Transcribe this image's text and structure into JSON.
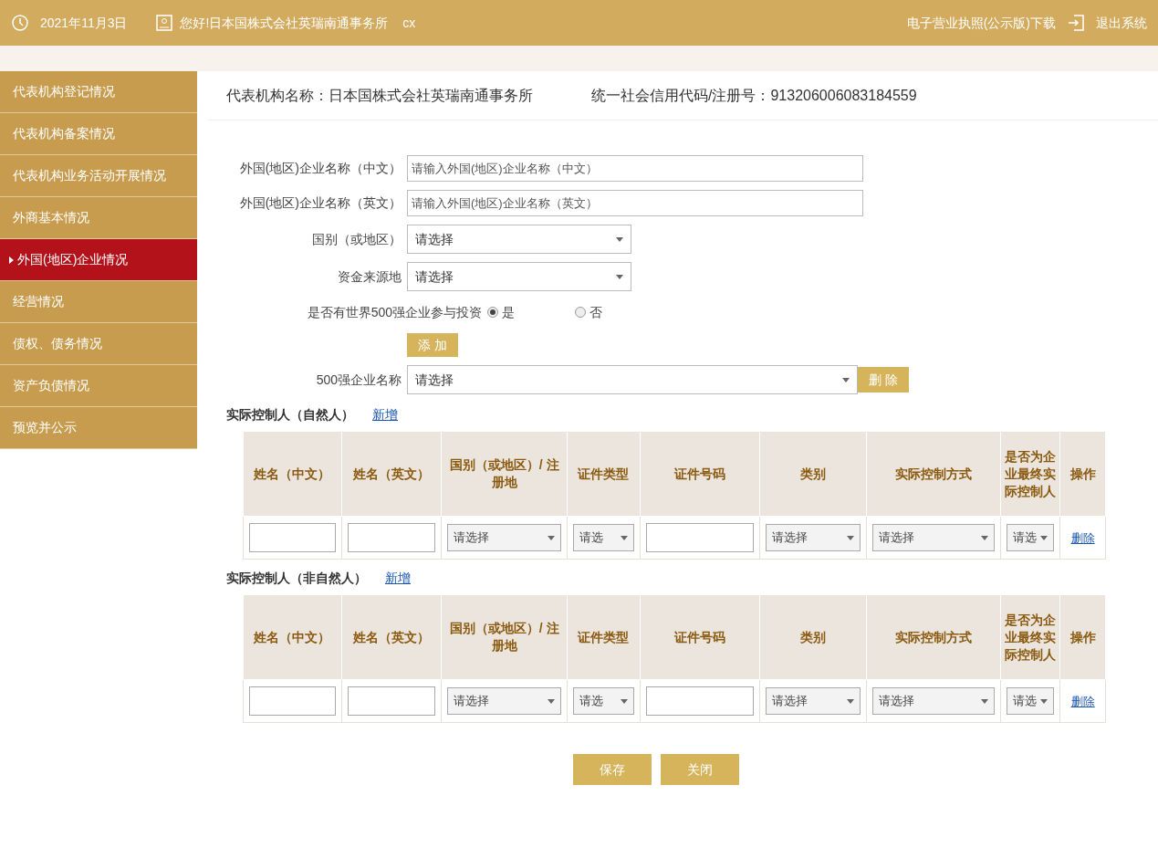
{
  "top_bar": {
    "date": "2021年11月3日",
    "greeting": "您好!日本国株式会社英瑞南通事务所",
    "user": "cx",
    "license_link": "电子营业执照(公示版)下载",
    "logout": "退出系统"
  },
  "sidebar": {
    "items": [
      {
        "label": "代表机构登记情况",
        "selected": false
      },
      {
        "label": "代表机构备案情况",
        "selected": false
      },
      {
        "label": "代表机构业务活动开展情况",
        "selected": false
      },
      {
        "label": "外商基本情况",
        "selected": false
      },
      {
        "label": "外国(地区)企业情况",
        "selected": true
      },
      {
        "label": "经营情况",
        "selected": false
      },
      {
        "label": "债权、债务情况",
        "selected": false
      },
      {
        "label": "资产负债情况",
        "selected": false
      },
      {
        "label": "预览并公示",
        "selected": false
      }
    ]
  },
  "header": {
    "org_label": "代表机构名称：",
    "org_name": "日本国株式会社英瑞南通事务所",
    "code_label": "统一社会信用代码/注册号：",
    "code": "913206006083184559"
  },
  "form": {
    "fields": [
      {
        "kind": "text",
        "label": "外国(地区)企业名称（中文）",
        "placeholder": "请输入外国(地区)企业名称（中文）"
      },
      {
        "kind": "text",
        "label": "外国(地区)企业名称（英文）",
        "placeholder": "请输入外国(地区)企业名称（英文）"
      },
      {
        "kind": "select",
        "label": "国别（或地区）",
        "value": "请选择"
      },
      {
        "kind": "select",
        "label": "资金来源地",
        "value": "请选择"
      }
    ],
    "radio": {
      "label": "是否有世界500强企业参与投资",
      "options": [
        {
          "label": "是",
          "selected": true
        },
        {
          "label": "否",
          "selected": false
        }
      ]
    },
    "add_button": "添 加",
    "top500": {
      "label": "500强企业名称",
      "value": "请选择",
      "delete_button": "删 除"
    }
  },
  "sections": [
    {
      "title": "实际控制人（自然人）",
      "add_link": "新增",
      "columns": [
        "姓名（中文）",
        "姓名（英文）",
        "国别（或地区）/ 注册地",
        "证件类型",
        "证件号码",
        "类别",
        "实际控制方式",
        "是否为企业最终实际控制人",
        "操作"
      ],
      "row": [
        {
          "kind": "input"
        },
        {
          "kind": "input"
        },
        {
          "kind": "select",
          "value": "请选择"
        },
        {
          "kind": "select",
          "value": "请选"
        },
        {
          "kind": "input"
        },
        {
          "kind": "select",
          "value": "请选择"
        },
        {
          "kind": "select",
          "value": "请选择"
        },
        {
          "kind": "select",
          "value": "请选"
        },
        {
          "kind": "link",
          "value": "删除"
        }
      ]
    },
    {
      "title": "实际控制人（非自然人）",
      "add_link": "新增",
      "columns": [
        "姓名（中文）",
        "姓名（英文）",
        "国别（或地区）/ 注册地",
        "证件类型",
        "证件号码",
        "类别",
        "实际控制方式",
        "是否为企业最终实际控制人",
        "操作"
      ],
      "row": [
        {
          "kind": "input"
        },
        {
          "kind": "input"
        },
        {
          "kind": "select",
          "value": "请选择"
        },
        {
          "kind": "select",
          "value": "请选"
        },
        {
          "kind": "input"
        },
        {
          "kind": "select",
          "value": "请选择"
        },
        {
          "kind": "select",
          "value": "请选择"
        },
        {
          "kind": "select",
          "value": "请选"
        },
        {
          "kind": "link",
          "value": "删除"
        }
      ]
    }
  ],
  "footer_buttons": [
    "保存",
    "关闭"
  ]
}
